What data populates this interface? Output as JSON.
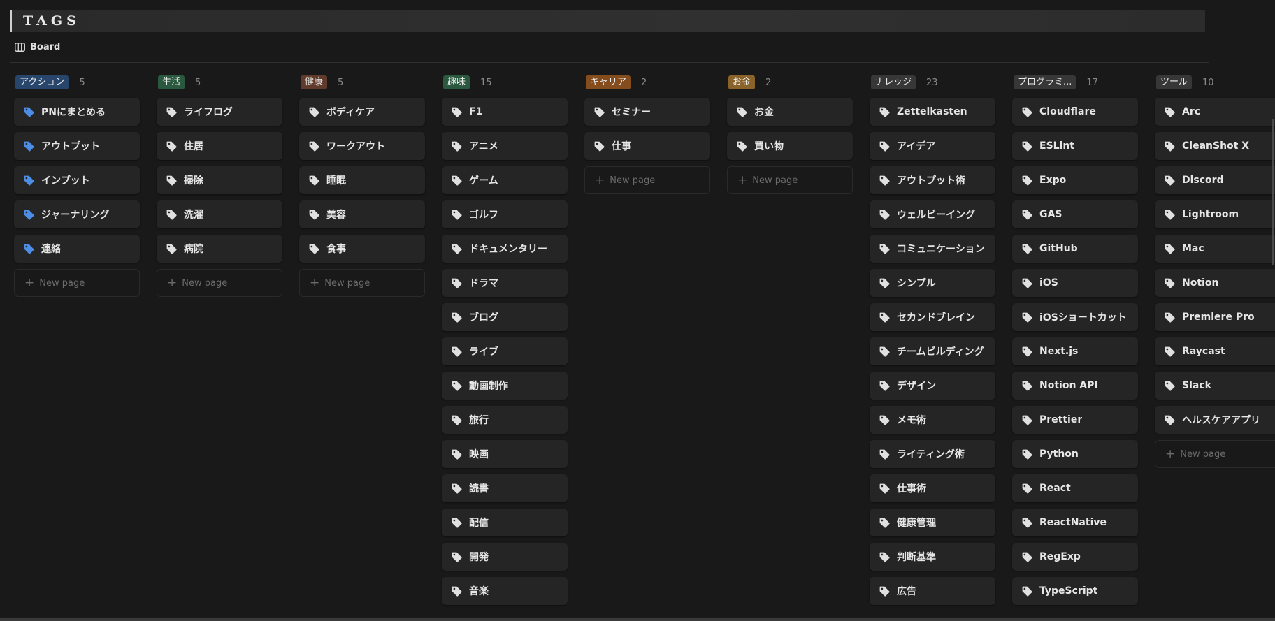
{
  "page": {
    "title": "TAGS"
  },
  "view": {
    "label": "Board",
    "icon": "board-view-icon"
  },
  "new_page_label": "New page",
  "colors": {
    "action": "#28456c",
    "life": "#2b593f",
    "health": "#603b2c",
    "hobby": "#2b593f",
    "career": "#854c1d",
    "money": "#89632a",
    "knowledge": "#373737",
    "programming": "#373737",
    "tools": "#373737",
    "blue_tag": "#4c8ee6",
    "gray_tag": "#e0e0e0"
  },
  "columns": [
    {
      "name": "アクション",
      "count": "5",
      "color_key": "action",
      "icon_color": "blue",
      "show_new": true,
      "items": [
        "PNにまとめる",
        "アウトプット",
        "インプット",
        "ジャーナリング",
        "連絡"
      ]
    },
    {
      "name": "生活",
      "count": "5",
      "color_key": "life",
      "icon_color": "gray",
      "show_new": true,
      "items": [
        "ライフログ",
        "住居",
        "掃除",
        "洗濯",
        "病院"
      ]
    },
    {
      "name": "健康",
      "count": "5",
      "color_key": "health",
      "icon_color": "gray",
      "show_new": true,
      "items": [
        "ボディケア",
        "ワークアウト",
        "睡眠",
        "美容",
        "食事"
      ]
    },
    {
      "name": "趣味",
      "count": "15",
      "color_key": "hobby",
      "icon_color": "gray",
      "show_new": false,
      "items": [
        "F1",
        "アニメ",
        "ゲーム",
        "ゴルフ",
        "ドキュメンタリー",
        "ドラマ",
        "ブログ",
        "ライブ",
        "動画制作",
        "旅行",
        "映画",
        "読書",
        "配信",
        "開発",
        "音楽"
      ]
    },
    {
      "name": "キャリア",
      "count": "2",
      "color_key": "career",
      "icon_color": "gray",
      "show_new": true,
      "items": [
        "セミナー",
        "仕事"
      ]
    },
    {
      "name": "お金",
      "count": "2",
      "color_key": "money",
      "icon_color": "gray",
      "show_new": true,
      "items": [
        "お金",
        "買い物"
      ]
    },
    {
      "name": "ナレッジ",
      "count": "23",
      "color_key": "knowledge",
      "icon_color": "gray",
      "show_new": false,
      "items": [
        "Zettelkasten",
        "アイデア",
        "アウトプット術",
        "ウェルビーイング",
        "コミュニケーション",
        "シンプル",
        "セカンドブレイン",
        "チームビルディング",
        "デザイン",
        "メモ術",
        "ライティング術",
        "仕事術",
        "健康管理",
        "判断基準",
        "広告"
      ]
    },
    {
      "name": "プログラミ...",
      "count": "17",
      "color_key": "programming",
      "icon_color": "gray",
      "show_new": false,
      "items": [
        "Cloudflare",
        "ESLint",
        "Expo",
        "GAS",
        "GitHub",
        "iOS",
        "iOSショートカット",
        "Next.js",
        "Notion API",
        " Prettier",
        "Python",
        "React",
        "ReactNative",
        "RegExp",
        "TypeScript"
      ]
    },
    {
      "name": "ツール",
      "count": "10",
      "color_key": "tools",
      "icon_color": "gray",
      "show_new": true,
      "items": [
        "Arc",
        "CleanShot X",
        "Discord",
        "Lightroom",
        "Mac",
        "Notion",
        "Premiere Pro",
        "Raycast",
        "Slack",
        "ヘルスケアアプリ"
      ]
    }
  ]
}
